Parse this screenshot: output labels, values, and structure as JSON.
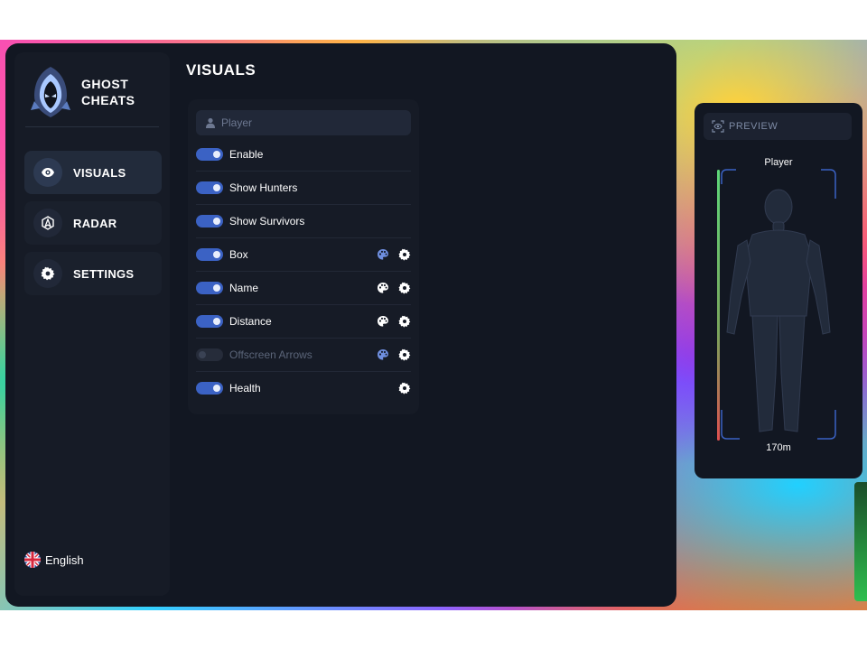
{
  "app": {
    "brand_line1": "GHOST",
    "brand_line2": "CHEATS",
    "accent_color": "#3b62c4"
  },
  "sidebar": {
    "items": [
      {
        "label": "VISUALS",
        "icon": "eye-icon",
        "active": true
      },
      {
        "label": "RADAR",
        "icon": "radar-icon",
        "active": false
      },
      {
        "label": "SETTINGS",
        "icon": "gear-icon",
        "active": false
      }
    ],
    "language": {
      "label": "English",
      "icon": "uk-flag-icon"
    }
  },
  "main": {
    "title": "VISUALS",
    "group_label": "Player",
    "options": [
      {
        "label": "Enable",
        "enabled": true,
        "color_picker": false,
        "settings": false
      },
      {
        "label": "Show Hunters",
        "enabled": true,
        "color_picker": false,
        "settings": false
      },
      {
        "label": "Show Survivors",
        "enabled": true,
        "color_picker": false,
        "settings": false
      },
      {
        "label": "Box",
        "enabled": true,
        "color_picker": true,
        "settings": true
      },
      {
        "label": "Name",
        "enabled": true,
        "color_picker": true,
        "settings": true
      },
      {
        "label": "Distance",
        "enabled": true,
        "color_picker": true,
        "settings": true
      },
      {
        "label": "Offscreen Arrows",
        "enabled": false,
        "color_picker": true,
        "settings": true
      },
      {
        "label": "Health",
        "enabled": true,
        "color_picker": false,
        "settings": true
      }
    ]
  },
  "preview": {
    "title": "PREVIEW",
    "player_name": "Player",
    "distance": "170m"
  }
}
